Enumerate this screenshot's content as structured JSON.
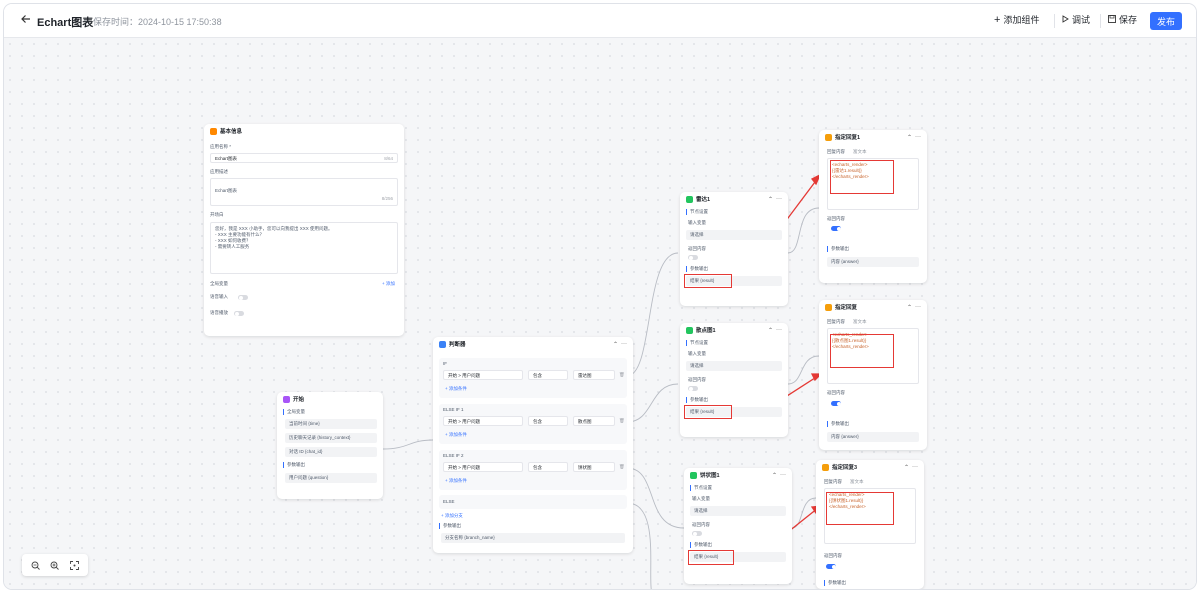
{
  "header": {
    "title": "Echart图表",
    "save_time": "保存时间：2024-10-15 17:50:38",
    "add_component": "添加组件",
    "debug": "调试",
    "save": "保存",
    "publish": "发布"
  },
  "basic_info": {
    "title": "基本信息",
    "app_name_label": "应用名称 *",
    "app_name_value": "Echart图表",
    "app_name_count": "8/64",
    "app_desc_label": "应用描述",
    "app_desc_value": "Echart图表",
    "app_desc_count": "8/256",
    "opening_label": "开场白",
    "opening_text": "您好，我是 XXX 小助手，您可以向我提出 XXX 使用问题。\n- XXX 主要功能有什么？\n- XXX 如何收费？\n- 需要转人工服务",
    "global_vars_label": "全局变量",
    "add_label": "+ 添加",
    "voice_input_label": "语音输入",
    "voice_play_label": "语音播放"
  },
  "start_node": {
    "title": "开始",
    "section": "全局变量",
    "fields": [
      "当前时间 {time}",
      "历史聊天记录 {history_context}",
      "对话 ID {chat_id}"
    ],
    "params_section": "参数输出",
    "param": "用户问题 {question}"
  },
  "judge_node": {
    "title": "判断器",
    "if_label": "IF",
    "elseif1_label": "ELSE IF 1",
    "elseif2_label": "ELSE IF 2",
    "else_label": "ELSE",
    "row1": {
      "var": "开始 > 用户问题",
      "op": "包含",
      "value": "雷达图"
    },
    "row2": {
      "var": "开始 > 用户问题",
      "op": "包含",
      "value": "散点图"
    },
    "row3": {
      "var": "开始 > 用户问题",
      "op": "包含",
      "value": "饼状图"
    },
    "add_condition": "+ 添加条件",
    "add_branch": "+ 添加分支",
    "params_section": "参数输出",
    "param": "分支名称 {branch_name}"
  },
  "radar_node": {
    "title": "雷达1",
    "section": "节点设置",
    "input_label": "输入变量",
    "input_value": "请选择",
    "return_label": "返回内容",
    "params_section": "参数输出",
    "result": "结果 {result}"
  },
  "scatter_node": {
    "title": "散点图1",
    "section": "节点设置",
    "input_label": "输入变量",
    "input_value": "请选择",
    "return_label": "返回内容",
    "params_section": "参数输出",
    "result": "结果 {result}"
  },
  "pie_node": {
    "title": "饼状图1",
    "section": "节点设置",
    "input_label": "输入变量",
    "input_value": "请选择",
    "return_label": "返回内容",
    "params_section": "参数输出",
    "result": "结果 {result}"
  },
  "reply1": {
    "title": "指定回复1",
    "content_label": "回复内容",
    "content_mode": "富文本",
    "code": "<echarts_render>\n{{雷达1.result}}\n</echarts_render>",
    "return_label": "返回内容",
    "params_section": "参数输出",
    "param": "内容 {answer}"
  },
  "reply2": {
    "title": "指定回复",
    "content_label": "回复内容",
    "content_mode": "富文本",
    "code": "<echarts_render>\n{{散点图1.result}}\n</echarts_render>",
    "return_label": "返回内容",
    "params_section": "参数输出",
    "param": "内容 {answer}"
  },
  "reply3": {
    "title": "指定回复3",
    "content_label": "回复内容",
    "content_mode": "富文本",
    "code": "<echarts_render>\n{{饼状图1.result}}\n</echarts_render>",
    "return_label": "返回内容",
    "params_section": "参数输出"
  },
  "menu_glyph": "···",
  "collapse_glyph": "⌃",
  "colors": {
    "primary": "#3370ff",
    "highlight": "#e53935",
    "basic_icon": "#ff8800",
    "start_icon": "#a855f7",
    "judge_icon": "#3b82f6",
    "function_icon": "#22c55e",
    "reply_icon": "#f59e0b"
  }
}
